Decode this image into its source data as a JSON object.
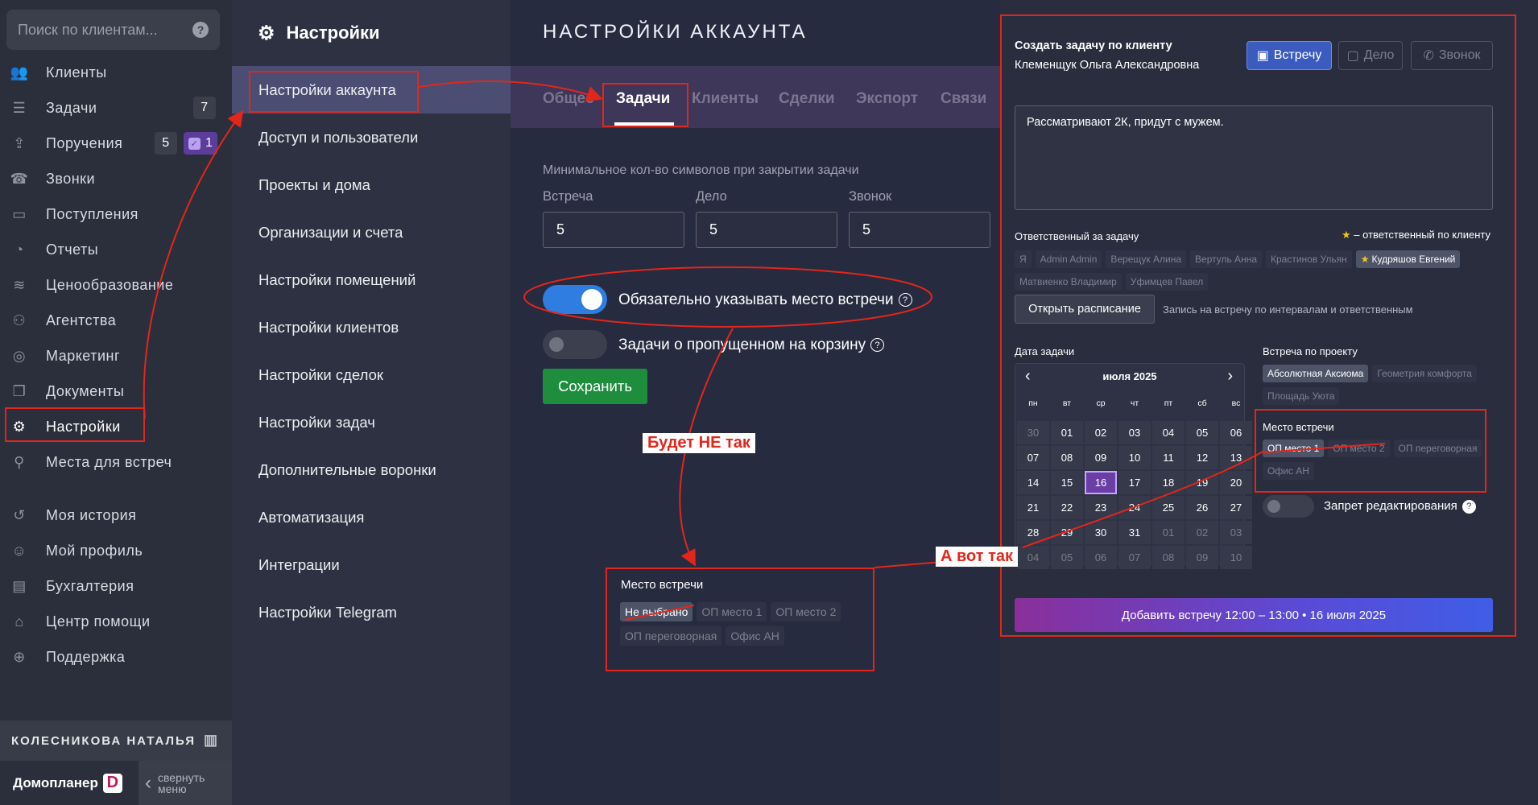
{
  "sidebar": {
    "search_placeholder": "Поиск по клиентам...",
    "items": [
      {
        "label": "Клиенты",
        "icon": "users-icon"
      },
      {
        "label": "Задачи",
        "icon": "tasks-icon",
        "badge": "7"
      },
      {
        "label": "Поручения",
        "icon": "inbox-icon",
        "badge": "5",
        "badge2": "1"
      },
      {
        "label": "Звонки",
        "icon": "phone-icon"
      },
      {
        "label": "Поступления",
        "icon": "wallet-icon"
      },
      {
        "label": "Отчеты",
        "icon": "pie-chart-icon"
      },
      {
        "label": "Ценообразование",
        "icon": "coins-icon"
      },
      {
        "label": "Агентства",
        "icon": "agency-icon"
      },
      {
        "label": "Маркетинг",
        "icon": "target-icon"
      },
      {
        "label": "Документы",
        "icon": "documents-icon"
      },
      {
        "label": "Настройки",
        "icon": "gear-icon"
      },
      {
        "label": "Места для встреч",
        "icon": "location-icon"
      }
    ],
    "items2": [
      {
        "label": "Моя история",
        "icon": "history-icon"
      },
      {
        "label": "Мой профиль",
        "icon": "profile-icon"
      },
      {
        "label": "Бухгалтерия",
        "icon": "accounting-icon"
      },
      {
        "label": "Центр помощи",
        "icon": "help-center-icon"
      },
      {
        "label": "Поддержка",
        "icon": "support-icon"
      }
    ],
    "user_name": "КОЛЕСНИКОВА НАТАЛЬЯ",
    "brand": "Домопланер",
    "brand_logo": "D",
    "collapse_line1": "свернуть",
    "collapse_line2": "меню"
  },
  "settings_menu": {
    "title": "Настройки",
    "items": [
      "Настройки аккаунта",
      "Доступ и пользователи",
      "Проекты и дома",
      "Организации и счета",
      "Настройки помещений",
      "Настройки клиентов",
      "Настройки сделок",
      "Настройки задач",
      "Дополнительные воронки",
      "Автоматизация",
      "Интеграции",
      "Настройки Telegram"
    ]
  },
  "main": {
    "title": "НАСТРОЙКИ АККАУНТА",
    "tabs": [
      "Общее",
      "Задачи",
      "Клиенты",
      "Сделки",
      "Экспорт",
      "Связи"
    ],
    "min_chars_label": "Минимальное кол-во символов при закрытии задачи",
    "fields": [
      {
        "label": "Встреча",
        "value": "5"
      },
      {
        "label": "Дело",
        "value": "5"
      },
      {
        "label": "Звонок",
        "value": "5"
      }
    ],
    "toggle1_label": "Обязательно указывать место встречи",
    "toggle1_on": true,
    "toggle2_label": "Задачи о пропущенном на корзину",
    "toggle2_on": false,
    "save_label": "Сохранить"
  },
  "annotations": {
    "wrong_label": "Будет НЕ так",
    "right_label": "А вот так",
    "colors": {
      "red": "#e3261b"
    }
  },
  "wrong_example": {
    "title": "Место встречи",
    "chips": [
      "Не выбрано",
      "ОП место 1",
      "ОП место 2",
      "ОП переговорная",
      "Офис АН"
    ]
  },
  "task_panel": {
    "title": "Создать задачу по клиенту",
    "client": "Клеменщук Ольга Александровна",
    "types": [
      "Встречу",
      "Дело",
      "Звонок"
    ],
    "note": "Рассматривают 2К, придут с мужем.",
    "responsible_label": "Ответственный за задачу",
    "responsible_hint": "– ответственный по клиенту",
    "responsibles": [
      "Я",
      "Admin Admin",
      "Верещук Алина",
      "Вертуль Анна",
      "Крастинов Ульян",
      "Кудряшов Евгений",
      "Матвиенко Владимир",
      "Уфимцев Павел"
    ],
    "open_schedule": "Открыть расписание",
    "schedule_hint": "Запись на встречу по интервалам и ответственным",
    "date_label": "Дата задачи",
    "month": "июля 2025",
    "weekdays": [
      "пн",
      "вт",
      "ср",
      "чт",
      "пт",
      "сб",
      "вс"
    ],
    "days": [
      "30",
      "01",
      "02",
      "03",
      "04",
      "05",
      "06",
      "07",
      "08",
      "09",
      "10",
      "11",
      "12",
      "13",
      "14",
      "15",
      "16",
      "17",
      "18",
      "19",
      "20",
      "21",
      "22",
      "23",
      "24",
      "25",
      "26",
      "27",
      "28",
      "29",
      "30",
      "31",
      "01",
      "02",
      "03",
      "04",
      "05",
      "06",
      "07",
      "08",
      "09",
      "10"
    ],
    "project_label": "Встреча по проекту",
    "projects": [
      "Абсолютная Аксиома",
      "Геометрия комфорта",
      "Площадь Уюта"
    ],
    "place_label": "Место встречи",
    "places": [
      "ОП место 1",
      "ОП место 2",
      "ОП переговорная",
      "Офис АН"
    ],
    "edit_lock_label": "Запрет редактирования",
    "add_button": "Добавить встречу 12:00 – 13:00 • 16 июля 2025"
  }
}
